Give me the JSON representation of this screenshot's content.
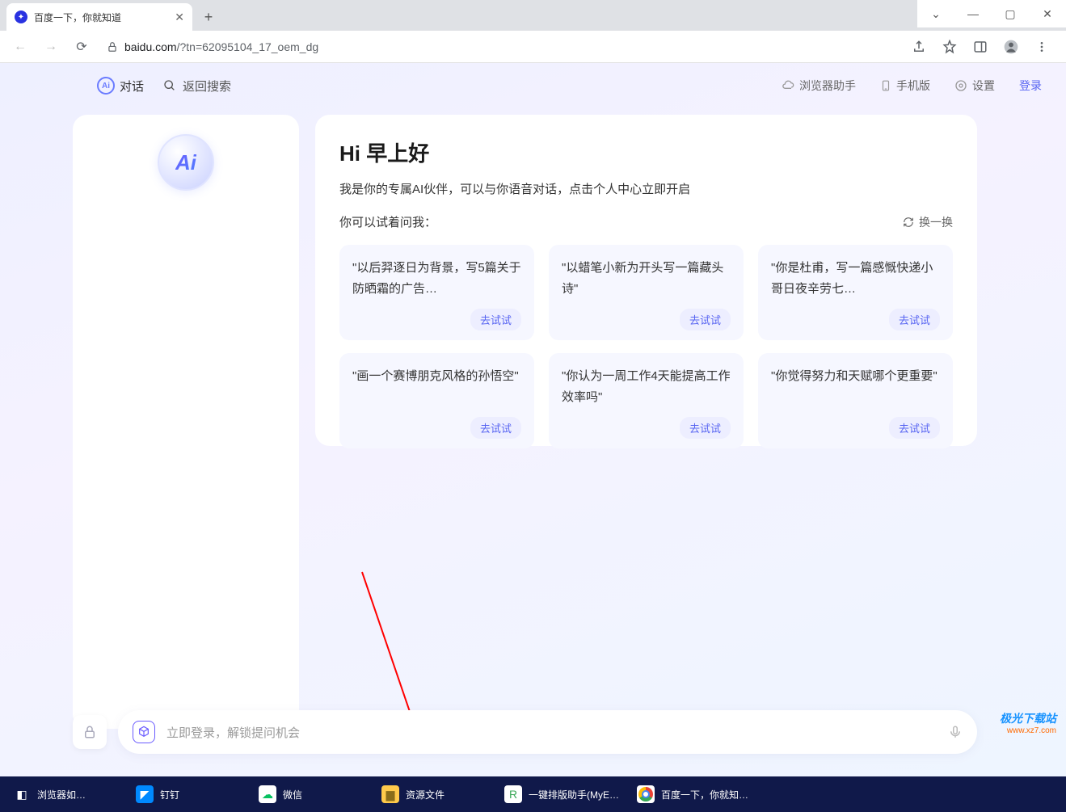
{
  "window": {
    "minimize": "—",
    "maximize": "▢",
    "close": "✕",
    "dropdown": "⌄"
  },
  "tab": {
    "title": "百度一下，你就知道"
  },
  "url": {
    "host": "baidu.com",
    "path": "/?tn=62095104_17_oem_dg"
  },
  "topbar": {
    "chat": "对话",
    "back_search": "返回搜索",
    "browser_helper": "浏览器助手",
    "mobile": "手机版",
    "settings": "设置",
    "login": "登录"
  },
  "ai_logo_text": "Ai",
  "greeting": "Hi 早上好",
  "intro": "我是你的专属AI伙伴，可以与你语音对话，点击个人中心立即开启",
  "try_label": "你可以试着问我：",
  "refresh_label": "换一换",
  "try_btn": "去试试",
  "prompts": [
    "\"以后羿逐日为背景，写5篇关于防晒霜的广告…",
    "\"以蜡笔小新为开头写一篇藏头诗\"",
    "\"你是杜甫，写一篇感慨快递小哥日夜辛劳七…",
    "\"画一个赛博朋克风格的孙悟空\"",
    "\"你认为一周工作4天能提高工作效率吗\"",
    "\"你觉得努力和天赋哪个更重要\""
  ],
  "input_placeholder": "立即登录，解锁提问机会",
  "taskbar": [
    "浏览器如…",
    "钉钉",
    "微信",
    "资源文件",
    "一键排版助手(MyE…",
    "百度一下，你就知…"
  ],
  "watermark": {
    "top": "极光下载站",
    "bottom": "www.xz7.com"
  }
}
